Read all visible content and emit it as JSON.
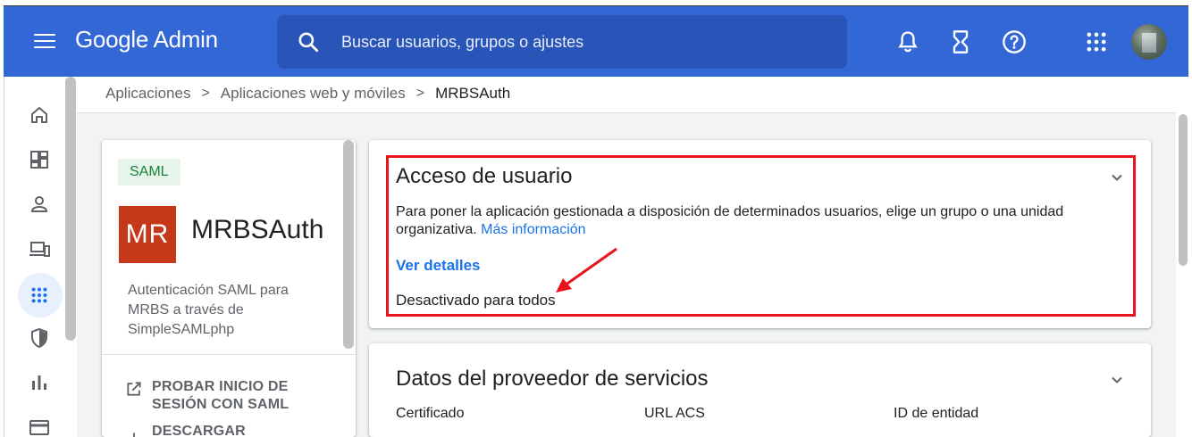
{
  "header": {
    "logo_google": "Google",
    "logo_admin": "Admin",
    "search_placeholder": "Buscar usuarios, grupos o ajustes",
    "icons": [
      "menu-icon",
      "search-icon",
      "notifications-bell-icon",
      "hourglass-icon",
      "help-icon",
      "apps-grid-icon",
      "avatar"
    ]
  },
  "rail": {
    "items": [
      "home-icon",
      "dashboard-icon",
      "user-icon",
      "devices-icon",
      "apps-icon",
      "security-shield-icon",
      "reports-bar-chart-icon",
      "billing-card-icon"
    ],
    "active": "apps-icon"
  },
  "breadcrumb": {
    "items": [
      "Aplicaciones",
      "Aplicaciones web y móviles",
      "MRBSAuth"
    ],
    "separator": ">"
  },
  "app_card": {
    "chip": "SAML",
    "logo_text": "MR",
    "logo_color": "#c5391a",
    "name": "MRBSAuth",
    "description": "Autenticación SAML para MRBS a través de SimpleSAMLphp",
    "actions": [
      {
        "label_line1": "PROBAR INICIO DE",
        "label_line2": "SESIÓN CON SAML",
        "icon": "open-in-new-icon"
      },
      {
        "label_line1": "DESCARGAR",
        "icon": "download-icon"
      }
    ]
  },
  "user_access": {
    "title": "Acceso de usuario",
    "description": "Para poner la aplicación gestionada a disposición de determinados usuarios, elige un grupo o una unidad organizativa.",
    "more_info_link": "Más información",
    "details_link": "Ver detalles",
    "status": "Desactivado para todos",
    "highlight_color": "#e8131b"
  },
  "service_provider": {
    "title": "Datos del proveedor de servicios",
    "columns": [
      "Certificado",
      "URL ACS",
      "ID de entidad"
    ]
  },
  "colors": {
    "appbar": "#3367d6",
    "search_bg": "#2a55b8",
    "link": "#1a73e8",
    "chip_bg": "#e6f4ea",
    "chip_text": "#188038"
  }
}
